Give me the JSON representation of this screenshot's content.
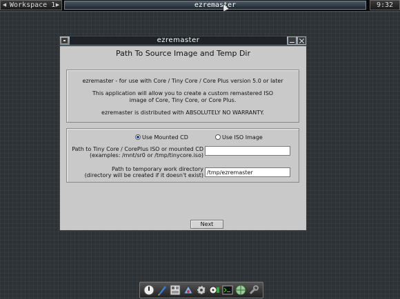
{
  "topbar": {
    "workspace_label": "Workspace 1",
    "prev_arrow": "◀",
    "next_arrow": "▶",
    "active_task": "ezremaster",
    "clock": "9:32"
  },
  "window": {
    "title": "ezremaster",
    "heading": "Path To Source Image and Temp Dir",
    "info_line1": "ezremaster - for use with Core / Tiny Core / Core Plus version 5.0 or later",
    "info_line2": "This application will allow you to create a custom remastered ISO",
    "info_line3": "image of Core, Tiny Core, or Core Plus.",
    "info_line4": "ezremaster is distributed with ABSOLUTELY NO WARRANTY.",
    "radio_mounted": "Use Mounted CD",
    "radio_iso": "Use ISO Image",
    "radio_selected": "mounted",
    "path_label_1": "Path to Tiny Core / CorePlus ISO or mounted CD",
    "path_label_2": "(examples:  /mnt/sr0 or  /tmp/tinycore.iso)",
    "path_value": "",
    "tmp_label_1": "Path to temporary work directory",
    "tmp_label_2": "(directory will be created if it doesn't exist)",
    "tmp_value": "/tmp/ezremaster",
    "next_label": "Next"
  },
  "dock": {
    "icons": [
      "power-icon",
      "editor-pen-icon",
      "apps-icon",
      "control-panel-icon",
      "settings-gear-icon",
      "mount-tool-icon",
      "terminal-icon",
      "web-browser-icon",
      "wrench-icon"
    ]
  }
}
